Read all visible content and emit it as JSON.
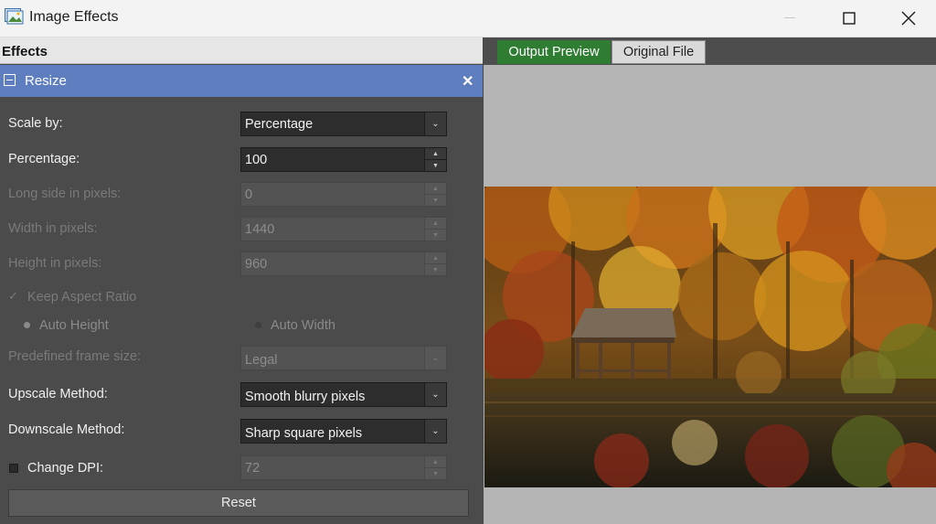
{
  "window": {
    "title": "Image Effects"
  },
  "panel": {
    "header": "Effects",
    "effect_name": "Resize"
  },
  "form": {
    "scale_by": {
      "label": "Scale by:",
      "value": "Percentage"
    },
    "percentage": {
      "label": "Percentage:",
      "value": "100"
    },
    "long_side": {
      "label": "Long side in pixels:",
      "value": "0"
    },
    "width": {
      "label": "Width in pixels:",
      "value": "1440"
    },
    "height": {
      "label": "Height in pixels:",
      "value": "960"
    },
    "keep_aspect": {
      "label": "Keep Aspect Ratio",
      "checked": true
    },
    "auto_height": {
      "label": "Auto Height",
      "selected": true
    },
    "auto_width": {
      "label": "Auto Width",
      "selected": false
    },
    "frame_size": {
      "label": "Predefined frame size:",
      "value": "Legal"
    },
    "upscale": {
      "label": "Upscale Method:",
      "value": "Smooth blurry pixels"
    },
    "downscale": {
      "label": "Downscale Method:",
      "value": "Sharp square pixels"
    },
    "change_dpi": {
      "label": "Change DPI:",
      "value": "72",
      "checked": false
    },
    "reset_label": "Reset"
  },
  "tabs": {
    "output": "Output Preview",
    "original": "Original File"
  },
  "colors": {
    "accent_bar": "#5e7ec0",
    "active_tab": "#2f7d32"
  }
}
